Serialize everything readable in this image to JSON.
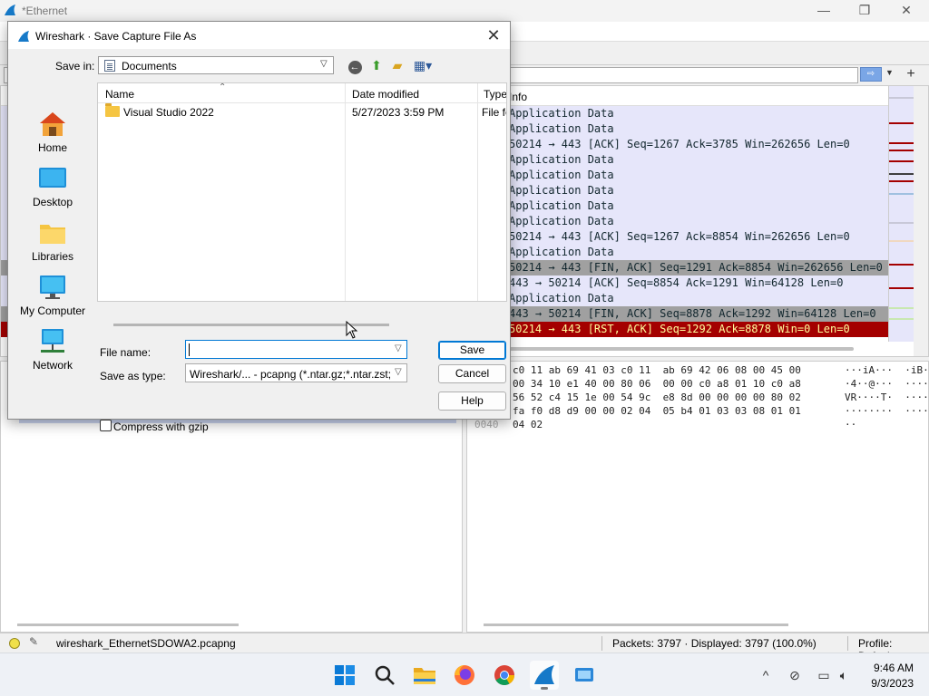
{
  "main_window": {
    "title": "*Ethernet",
    "controls": {
      "minimize": "—",
      "maximize": "❐",
      "close": "✕"
    },
    "filter": {
      "apply_glyph": "⇨",
      "add_glyph": "+"
    },
    "packet_list": {
      "info_header": "Info",
      "rows": [
        {
          "info": "Application Data",
          "style": "normal"
        },
        {
          "info": "Application Data",
          "style": "normal"
        },
        {
          "info": "50214 → 443 [ACK] Seq=1267 Ack=3785 Win=262656 Len=0",
          "style": "normal"
        },
        {
          "info": "Application Data",
          "style": "normal"
        },
        {
          "info": "Application Data",
          "style": "normal"
        },
        {
          "info": "Application Data",
          "style": "normal"
        },
        {
          "info": "Application Data",
          "style": "normal"
        },
        {
          "info": "Application Data",
          "style": "normal"
        },
        {
          "info": "50214 → 443 [ACK] Seq=1267 Ack=8854 Win=262656 Len=0",
          "style": "normal"
        },
        {
          "info": "Application Data",
          "style": "normal"
        },
        {
          "info": "50214 → 443 [FIN, ACK] Seq=1291 Ack=8854 Win=262656 Len=0",
          "style": "fin"
        },
        {
          "info": "443 → 50214 [ACK] Seq=8854 Ack=1291 Win=64128 Len=0",
          "style": "normal"
        },
        {
          "info": "Application Data",
          "style": "normal"
        },
        {
          "info": "443 → 50214 [FIN, ACK] Seq=8878 Ack=1292 Win=64128 Len=0",
          "style": "fin"
        },
        {
          "info": "50214 → 443 [RST, ACK] Seq=1292 Ack=8878 Win=0 Len=0",
          "style": "rst"
        }
      ]
    },
    "bytes_pane": {
      "rows": [
        {
          "offset": "",
          "hex": "c0 11 ab 69 41 03 c0 11  ab 69 42 06 08 00 45 00",
          "ascii": "···iA···  ·iB···E·"
        },
        {
          "offset": "",
          "hex": "00 34 10 e1 40 00 80 06  00 00 c0 a8 01 10 c0 a8",
          "ascii": "·4··@···  ········"
        },
        {
          "offset": "",
          "hex": "56 52 c4 15 1e 00 54 9c  e8 8d 00 00 00 00 80 02",
          "ascii": "VR····T·  ········"
        },
        {
          "offset": "",
          "hex": "fa f0 d8 d9 00 00 02 04  05 b4 01 03 03 08 01 01",
          "ascii": "········  ········"
        },
        {
          "offset": "0040",
          "hex": "04 02",
          "ascii": "··"
        }
      ]
    },
    "statusbar": {
      "file": "wireshark_EthernetSDOWA2.pcapng",
      "packets": "Packets: 3797 · Displayed: 3797 (100.0%)",
      "profile": "Profile: Default"
    }
  },
  "dialog": {
    "title": "Wireshark · Save Capture File As",
    "close_glyph": "✕",
    "save_in": {
      "label": "Save in:",
      "value": "Documents"
    },
    "places": [
      {
        "label": "Home",
        "icon": "home-icon"
      },
      {
        "label": "Desktop",
        "icon": "desktop-icon"
      },
      {
        "label": "Libraries",
        "icon": "libraries-icon"
      },
      {
        "label": "My Computer",
        "icon": "computer-icon"
      },
      {
        "label": "Network",
        "icon": "network-icon"
      }
    ],
    "file_list": {
      "columns": {
        "name": "Name",
        "date": "Date modified",
        "type": "Type"
      },
      "rows": [
        {
          "name": "Visual Studio 2022",
          "date": "5/27/2023 3:59 PM",
          "type": "File folder"
        }
      ]
    },
    "file_name": {
      "label": "File name:",
      "value": ""
    },
    "save_type": {
      "label": "Save as type:",
      "value": "Wireshark/... - pcapng (*.ntar.gz;*.ntar.zst;*.ntar"
    },
    "buttons": {
      "save": "Save",
      "cancel": "Cancel",
      "help": "Help"
    },
    "compress": {
      "label": "Compress with gzip",
      "checked": false
    }
  },
  "taskbar": {
    "apps": [
      "windows-start-icon",
      "search-icon",
      "file-explorer-icon",
      "firefox-icon",
      "chrome-icon",
      "wireshark-icon",
      "remote-desktop-icon"
    ],
    "tray": {
      "chevron": "^"
    },
    "clock": {
      "time": "9:46 AM",
      "date": "9/3/2023"
    }
  },
  "colors": {
    "accent": "#0078d4",
    "pkt_normal_bg": "#e6e6fa",
    "pkt_fin_bg": "#a0a0a0",
    "pkt_rst_bg": "#a40000",
    "pkt_rst_fg": "#fffc9c",
    "wireshark_fin": "#1679c8"
  }
}
